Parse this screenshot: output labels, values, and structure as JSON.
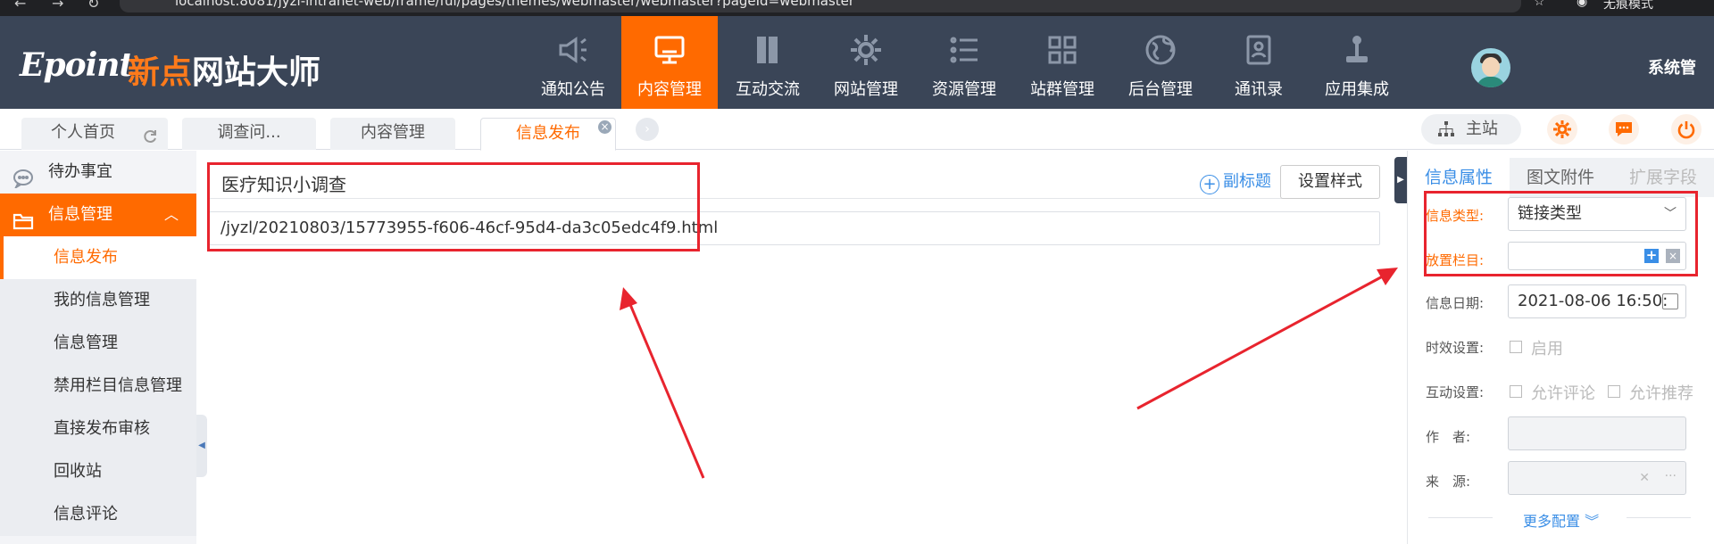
{
  "browser": {
    "url": "localhost:8081/jyzl-intranet-web/frame/fui/pages/themes/webmaster/webmaster?pageId=webmaster",
    "profile_label": "无痕模式"
  },
  "header": {
    "logo_en": "Epoint",
    "logo_cn_accent": "新点",
    "logo_cn_rest": "网站大师",
    "nav": [
      {
        "label": "通知公告",
        "icon": "megaphone-icon"
      },
      {
        "label": "内容管理",
        "icon": "monitor-icon",
        "active": true
      },
      {
        "label": "互动交流",
        "icon": "books-icon"
      },
      {
        "label": "网站管理",
        "icon": "gear-icon"
      },
      {
        "label": "资源管理",
        "icon": "list-icon"
      },
      {
        "label": "站群管理",
        "icon": "grid-icon"
      },
      {
        "label": "后台管理",
        "icon": "globe-icon"
      },
      {
        "label": "通讯录",
        "icon": "contacts-icon"
      },
      {
        "label": "应用集成",
        "icon": "joystick-icon"
      }
    ],
    "username": "系统管"
  },
  "tabs": {
    "items": [
      {
        "label": "个人首页"
      },
      {
        "label": "调查问..."
      },
      {
        "label": "内容管理"
      },
      {
        "label": "信息发布",
        "active": true
      }
    ],
    "station_label": "主站"
  },
  "sidebar": {
    "todo_label": "待办事宜",
    "group_label": "信息管理",
    "items": [
      {
        "label": "信息发布",
        "active": true
      },
      {
        "label": "我的信息管理"
      },
      {
        "label": "信息管理"
      },
      {
        "label": "禁用栏目信息管理"
      },
      {
        "label": "直接发布审核"
      },
      {
        "label": "回收站"
      },
      {
        "label": "信息评论"
      }
    ]
  },
  "editor": {
    "title": "医疗知识小调查",
    "subtitle_button": "副标题",
    "style_button": "设置样式",
    "link_url": "/jyzl/20210803/15773955-f606-46cf-95d4-da3c05edc4f9.html"
  },
  "right_panel": {
    "tabs": [
      {
        "label": "信息属性",
        "state": "active"
      },
      {
        "label": "图文附件",
        "state": "inactive"
      },
      {
        "label": "扩展字段",
        "state": "disabled"
      }
    ],
    "info_type_label": "信息类型:",
    "info_type_value": "链接类型",
    "column_label": "放置栏目:",
    "date_label": "信息日期:",
    "date_value": "2021-08-06 16:50:",
    "validity_label": "时效设置:",
    "validity_option": "启用",
    "interaction_label": "互动设置:",
    "allow_comment": "允许评论",
    "allow_recommend": "允许推荐",
    "author_label": "作　者:",
    "source_label": "来　源:",
    "more_config": "更多配置"
  },
  "colors": {
    "header_bg": "#3a4557",
    "accent_orange": "#ff6a00",
    "link_blue": "#3a8ee6",
    "annotation_red": "#e8242e"
  }
}
